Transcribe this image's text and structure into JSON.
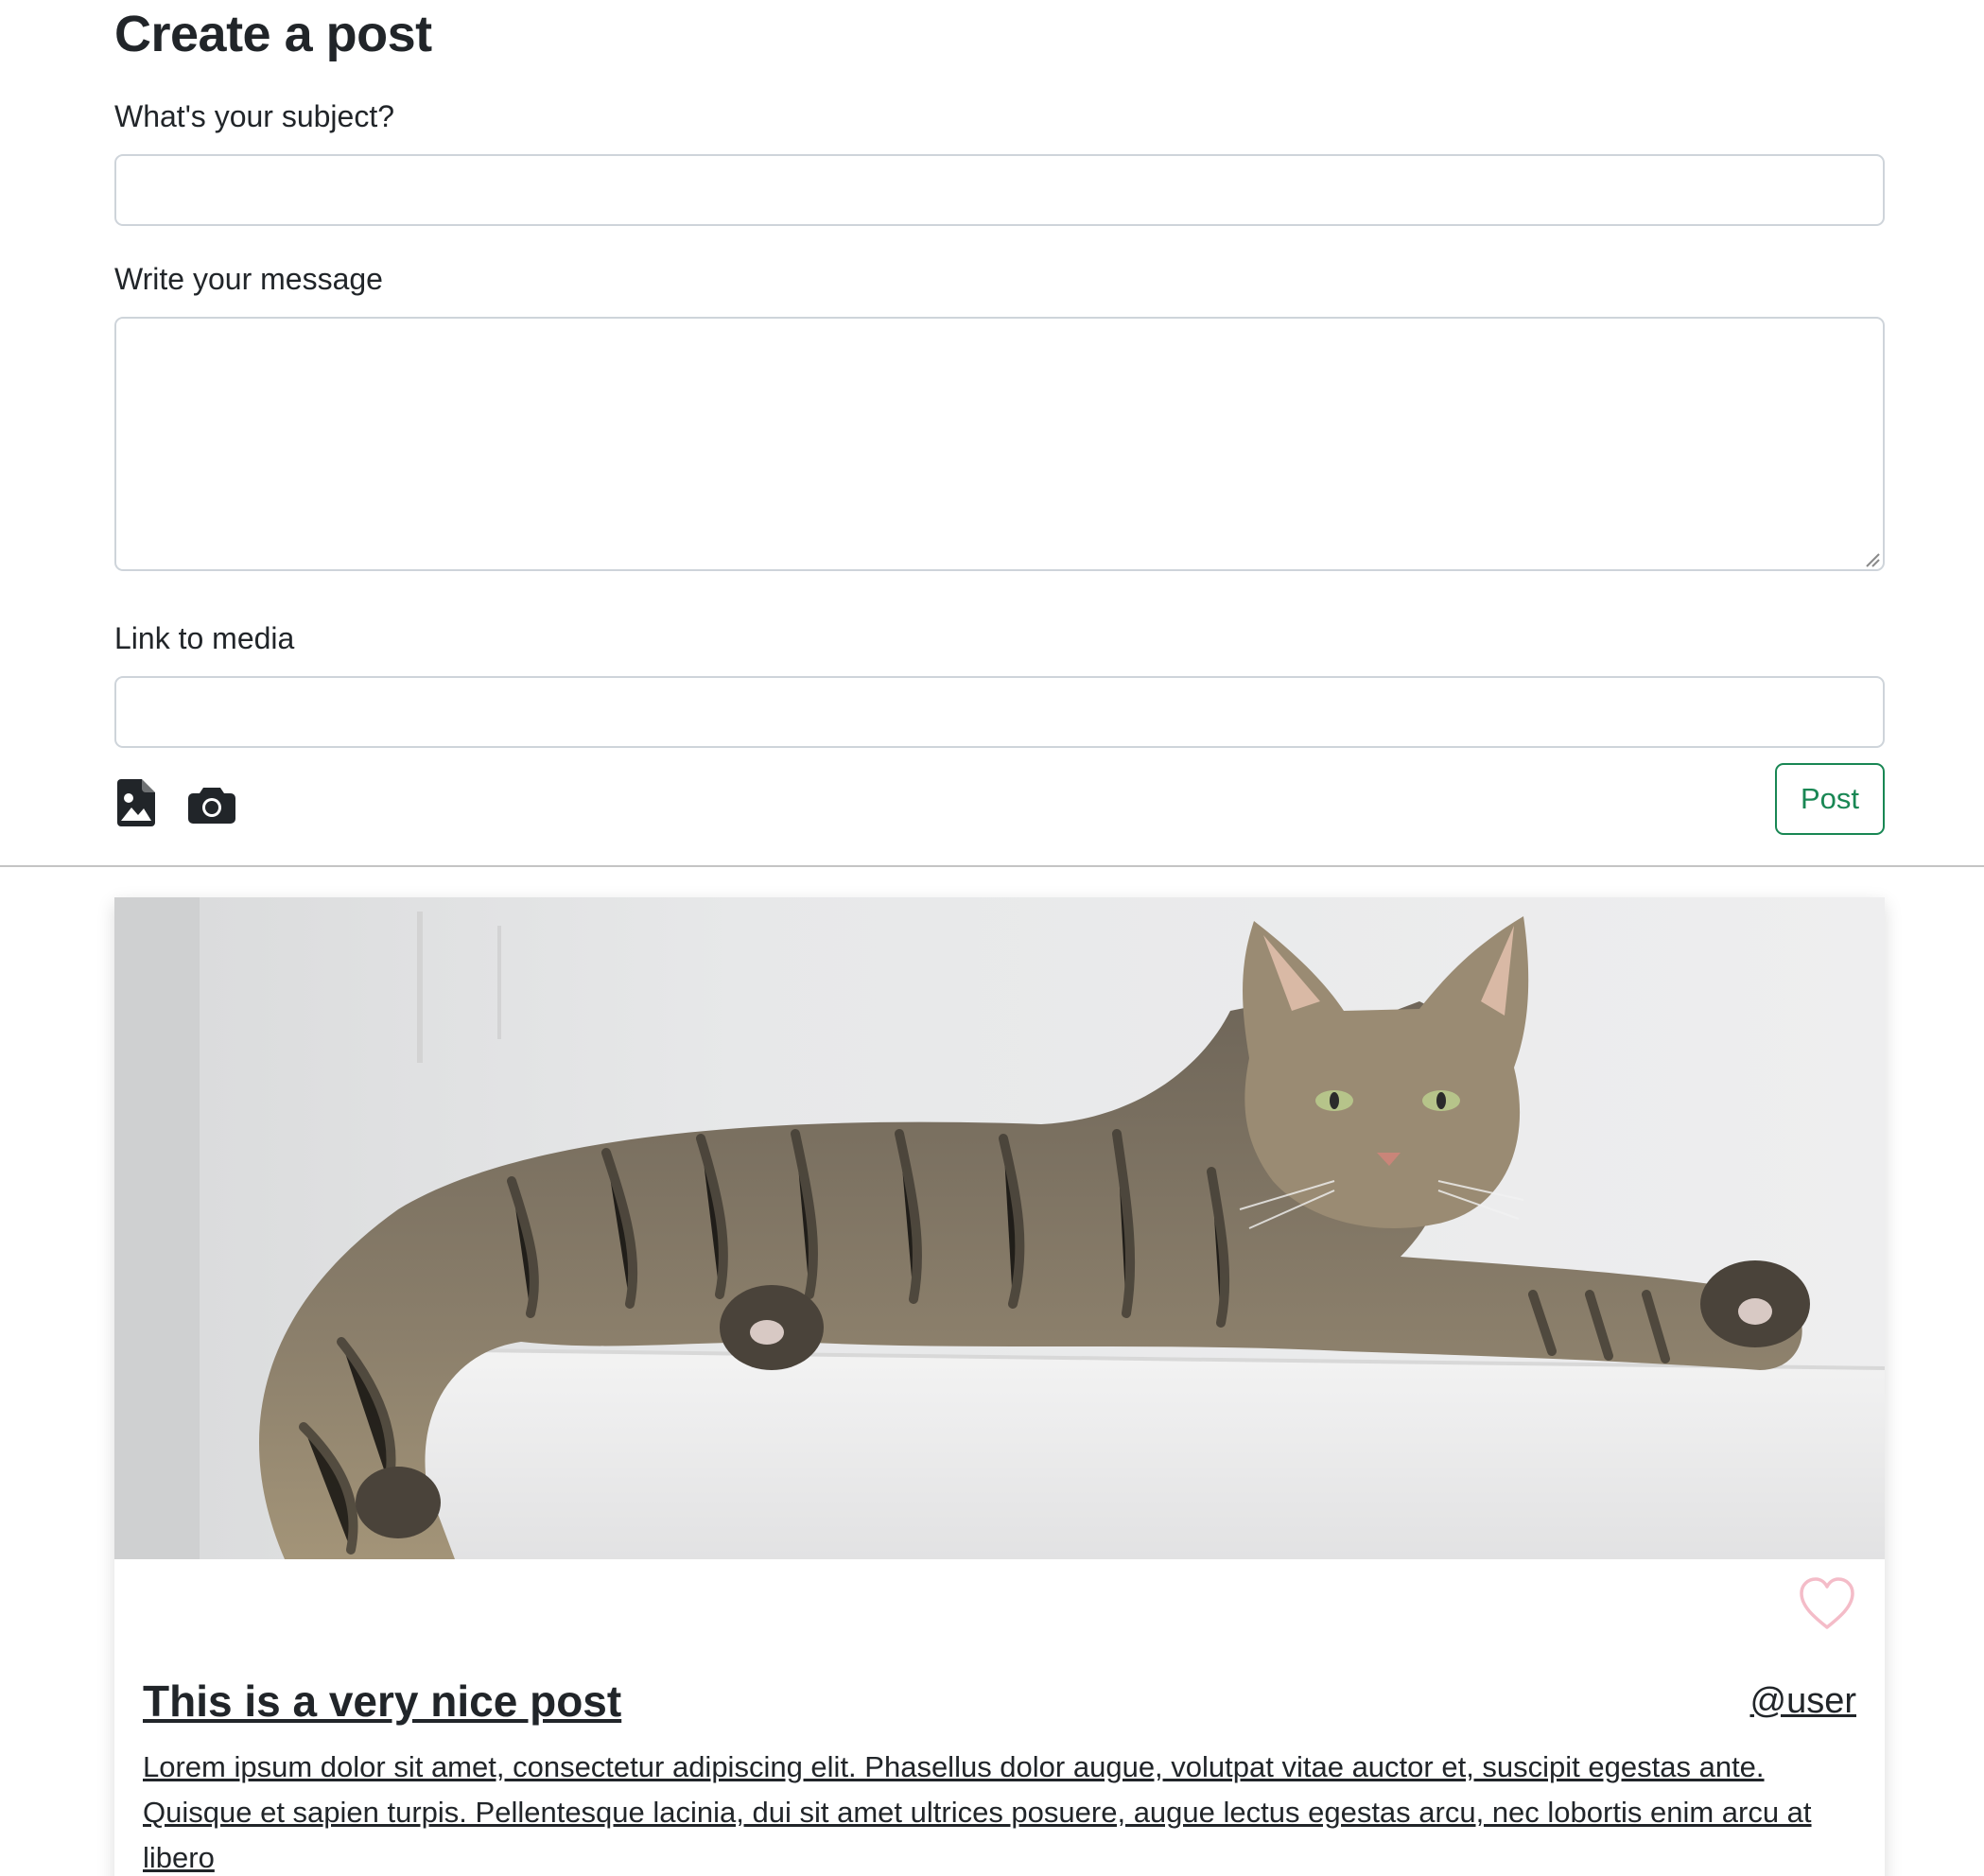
{
  "form": {
    "title": "Create a post",
    "subject_label": "What's your subject?",
    "subject_value": "",
    "message_label": "Write your message",
    "message_value": "",
    "media_label": "Link to media",
    "media_value": "",
    "post_button": "Post",
    "icons": [
      "image-file-icon",
      "camera-icon"
    ]
  },
  "post": {
    "title": "This is a very nice post",
    "user": "@user",
    "body": "Lorem ipsum dolor sit amet, consectetur adipiscing elit. Phasellus dolor augue, volutpat vitae auctor et, suscipit egestas ante. Quisque et sapien turpis. Pellentesque lacinia, dui sit amet ultrices posuere, augue lectus egestas arcu, nec lobortis enim arcu at libero",
    "image_icon": "cat-photo",
    "like_icon": "heart-outline-icon"
  },
  "colors": {
    "accent_green": "#198754",
    "heart_pink": "#f4bcc8",
    "text": "#212529",
    "input_border": "#ced4da"
  }
}
